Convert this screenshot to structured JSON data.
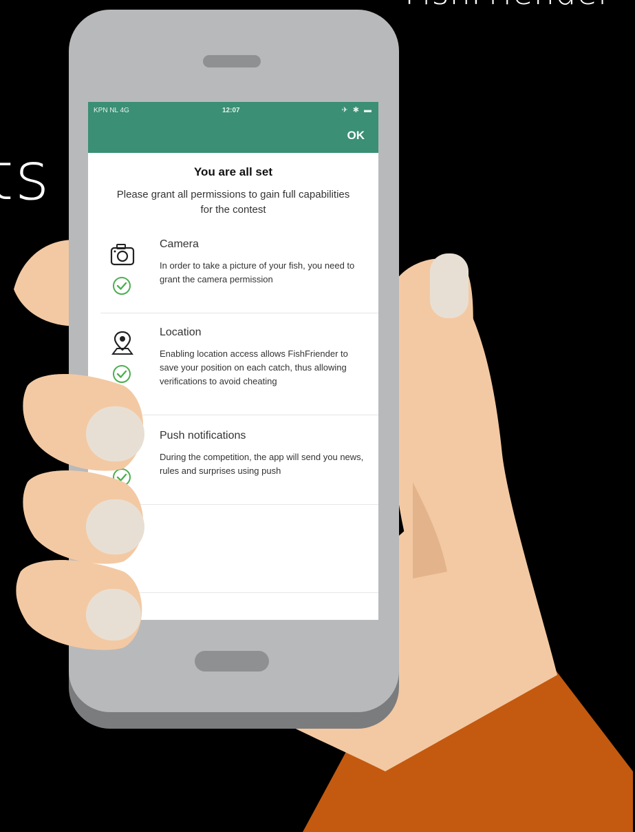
{
  "background": {
    "top_text": "FishFriender",
    "left_text": "ts"
  },
  "status_bar": {
    "carrier": "KPN NL  4G",
    "time": "12:07",
    "indicators": "✈ ✱ ▬"
  },
  "navbar": {
    "ok_label": "OK",
    "color": "#3a8f74"
  },
  "screen": {
    "title": "You are all set",
    "subtitle": "Please grant all permissions to gain full capabilities for the contest"
  },
  "permissions": [
    {
      "title": "Camera",
      "description": "In order to take a picture of your fish, you need to grant the camera permission",
      "icon": "camera-icon",
      "granted": true
    },
    {
      "title": "Location",
      "description": "Enabling location access allows FishFriender to save your position on each catch, thus allowing verifications to avoid cheating",
      "icon": "location-pin-icon",
      "granted": true
    },
    {
      "title": "Push notifications",
      "description": "During the competition, the app will send you news, rules and surprises using push",
      "icon": "bell-icon",
      "granted": true
    }
  ],
  "colors": {
    "accent_green": "#3a8f74",
    "check_green": "#4caf50",
    "skin": "#f3c9a3",
    "sleeve": "#c35a10"
  }
}
